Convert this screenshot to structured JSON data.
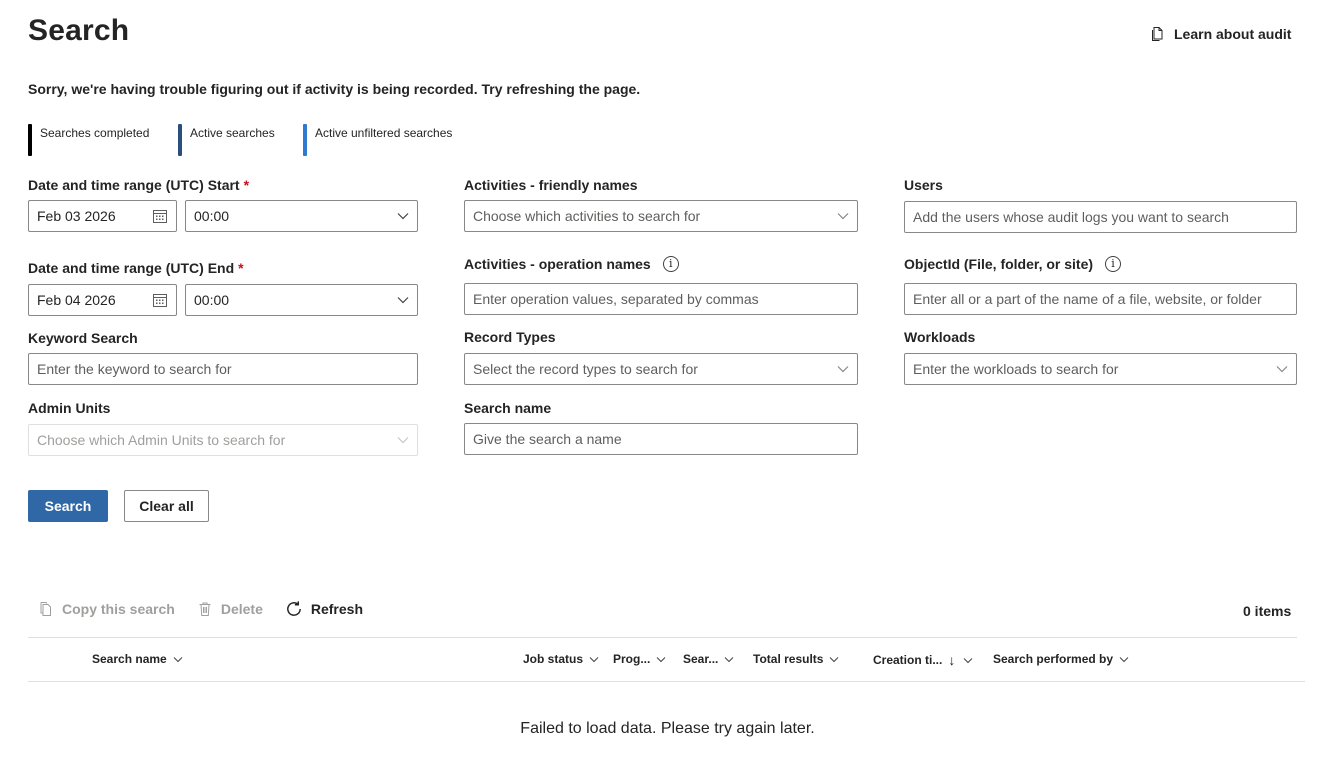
{
  "header": {
    "title": "Search",
    "learn_label": "Learn about audit"
  },
  "warning": "Sorry, we're having trouble figuring out if activity is being recorded. Try refreshing the page.",
  "legend": [
    {
      "label": "Searches completed",
      "color": "#000000"
    },
    {
      "label": "Active searches",
      "color": "#2b4f7d"
    },
    {
      "label": "Active unfiltered searches",
      "color": "#2f7ad1"
    }
  ],
  "form": {
    "start_label": "Date and time range (UTC) Start",
    "start_date": "Feb 03 2026",
    "start_time": "00:00",
    "end_label": "Date and time range (UTC) End",
    "end_date": "Feb 04 2026",
    "end_time": "00:00",
    "required_mark": "*",
    "activities_friendly_label": "Activities - friendly names",
    "activities_friendly_placeholder": "Choose which activities to search for",
    "activities_operation_label": "Activities - operation names",
    "activities_operation_placeholder": "Enter operation values, separated by commas",
    "users_label": "Users",
    "users_placeholder": "Add the users whose audit logs you want to search",
    "objectid_label": "ObjectId (File, folder, or site)",
    "objectid_placeholder": "Enter all or a part of the name of a file, website, or folder",
    "keyword_label": "Keyword Search",
    "keyword_placeholder": "Enter the keyword to search for",
    "record_types_label": "Record Types",
    "record_types_placeholder": "Select the record types to search for",
    "workloads_label": "Workloads",
    "workloads_placeholder": "Enter the workloads to search for",
    "admin_units_label": "Admin Units",
    "admin_units_placeholder": "Choose which Admin Units to search for",
    "search_name_label": "Search name",
    "search_name_placeholder": "Give the search a name",
    "info_glyph": "i"
  },
  "buttons": {
    "search": "Search",
    "clear_all": "Clear all"
  },
  "toolbar": {
    "copy": "Copy this search",
    "delete": "Delete",
    "refresh": "Refresh",
    "item_count": "0 items"
  },
  "table": {
    "columns": [
      "Search name",
      "Job status",
      "Prog...",
      "Sear...",
      "Total results",
      "Creation ti...",
      "Search performed by"
    ],
    "sort_arrow": "↓",
    "empty_message": "Failed to load data. Please try again later."
  },
  "colors": {
    "primary": "#2f67a7",
    "required": "#c50f1f"
  }
}
